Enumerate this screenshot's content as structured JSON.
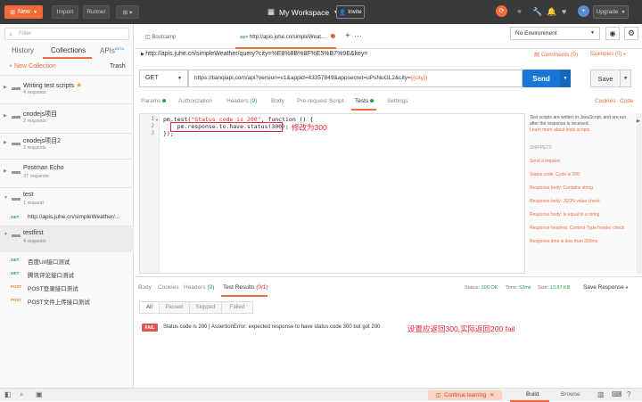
{
  "topbar": {
    "new_label": "New",
    "import_label": "Import",
    "runner_label": "Runner",
    "workspace_label": "My Workspace",
    "invite_label": "Invite",
    "upgrade_label": "Upgrade"
  },
  "sidebar": {
    "filter_placeholder": "Filter",
    "tab_history": "History",
    "tab_collections": "Collections",
    "tab_apis": "APIs",
    "apis_badge": "BETA",
    "new_collection": "+ New Collection",
    "trash": "Trash",
    "collections": [
      {
        "name": "Writing test scripts",
        "requests": "4 requests",
        "starred": true
      },
      {
        "name": "cnodejs项目",
        "requests": "2 requests"
      },
      {
        "name": "cnodejs项目2",
        "requests": "2 requests"
      },
      {
        "name": "Postman Echo",
        "requests": "37 requests"
      },
      {
        "name": "test",
        "requests": "1 request",
        "child": {
          "method": "GET",
          "url": "http://apis.juhe.cn/simpleWeather/..."
        }
      },
      {
        "name": "testfirst",
        "requests": "4 requests"
      }
    ],
    "testfirst_requests": [
      {
        "method": "GET",
        "name": "百度Url接口测试"
      },
      {
        "method": "GET",
        "name": "腾讯评论接口测试"
      },
      {
        "method": "POST",
        "name": "POST登录接口测试"
      },
      {
        "method": "POST",
        "name": "POST文件上传接口测试"
      }
    ]
  },
  "tabs": {
    "tab1": "Bootcamp",
    "tab2_method": "GET",
    "tab2_label": "http://apis.juhe.cn/simpleWeat..."
  },
  "env": {
    "selected": "No Environment"
  },
  "request": {
    "title_url": "http://apis.juhe.cn/simpleWeather/query?city=%E8%8B%8F%E5%B7%9E&key=",
    "comments": "Comments (0)",
    "examples": "Examples (0)",
    "method": "GET",
    "url_text": "https://tianqiapi.com/api?version=v1&appid=43357849&appsecret=uPsNuGL2&city=",
    "url_var": "{{city}}",
    "send": "Send",
    "save": "Save"
  },
  "req_tabs": {
    "params": "Params",
    "authorization": "Authorization",
    "headers": "Headers",
    "headers_count": "(9)",
    "body": "Body",
    "prerequest": "Pre-request Script",
    "tests": "Tests",
    "settings": "Settings",
    "cookies": "Cookies",
    "code": "Code"
  },
  "editor": {
    "line_numbers": [
      "1",
      "2",
      "3"
    ],
    "line1_pre": "pm.test(",
    "line1_str": "\"Status code is 200\"",
    "line1_post": ", function () {",
    "line2": "    pm.response.to.have.status(300);",
    "line3": "});",
    "annotation": "修改为300"
  },
  "snippets": {
    "desc": "Test scripts are written in JavaScript, and are run after the response is received.",
    "learn_more": "Learn more about tests scripts",
    "heading": "SNIPPETS",
    "items": [
      "Send a request",
      "Status code: Code is 200",
      "Response body: Contains string",
      "Response body: JSON value check",
      "Response body: Is equal to a string",
      "Response headers: Content-Type header check",
      "Response time is less than 200ms"
    ]
  },
  "response": {
    "body": "Body",
    "cookies": "Cookies",
    "headers": "Headers",
    "headers_count": "(9)",
    "test_results": "Test Results",
    "test_results_count": "(0/1)",
    "status_label": "Status:",
    "status_value": "200 OK",
    "time_label": "Time:",
    "time_value": "52ms",
    "size_label": "Size:",
    "size_value": "13.87 KB",
    "save_response": "Save Response",
    "filters": [
      "All",
      "Passed",
      "Skipped",
      "Failed"
    ],
    "fail_badge": "FAIL",
    "fail_message": "Status code is 200 | AssertionError: expected response to have status code 300 but got 200",
    "annotation": "设置应返回300,实际返回200 fail"
  },
  "bottom": {
    "continue_learning": "Continue learning",
    "build": "Build",
    "browse": "Browse"
  },
  "colors": {
    "accent": "#f26b3a",
    "send_blue": "#1877d6",
    "annotation_red": "#e23",
    "get_green": "#2a9c48",
    "post_orange": "#e6822a"
  }
}
